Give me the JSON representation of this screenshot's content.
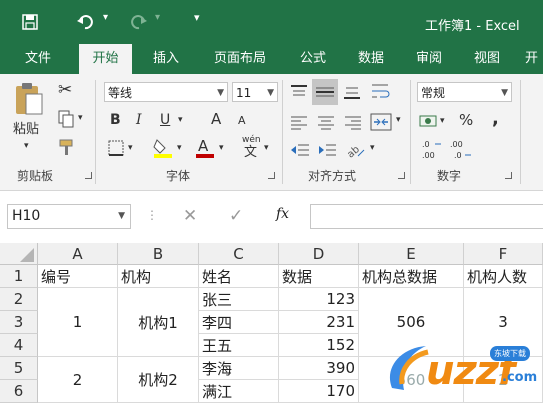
{
  "app": {
    "window_title": "工作簿1 - Excel"
  },
  "quick_access": {
    "save": "save-icon",
    "undo": "undo-icon",
    "redo": "redo-icon",
    "customize": "▾"
  },
  "tabs": [
    {
      "label": "文件"
    },
    {
      "label": "开始"
    },
    {
      "label": "插入"
    },
    {
      "label": "页面布局"
    },
    {
      "label": "公式"
    },
    {
      "label": "数据"
    },
    {
      "label": "审阅"
    },
    {
      "label": "视图"
    },
    {
      "label": "开"
    }
  ],
  "ribbon": {
    "clipboard": {
      "paste_label": "粘贴",
      "group_label": "剪贴板"
    },
    "font": {
      "font_name": "等线",
      "font_size": "11",
      "bold": "B",
      "italic": "I",
      "underline": "U",
      "grow": "A",
      "shrink": "A",
      "phonetic": "wén",
      "group_label": "字体"
    },
    "alignment": {
      "group_label": "对齐方式"
    },
    "number": {
      "format": "常规",
      "percent": "%",
      "comma": ",",
      "group_label": "数字"
    }
  },
  "formula_bar": {
    "name_box": "H10",
    "fx": "fx",
    "value": ""
  },
  "columns": [
    "A",
    "B",
    "C",
    "D",
    "E",
    "F"
  ],
  "rows": [
    "1",
    "2",
    "3",
    "4",
    "5",
    "6"
  ],
  "cells": {
    "A1": "编号",
    "B1": "机构",
    "C1": "姓名",
    "D1": "数据",
    "E1": "机构总数据",
    "F1": "机构人数",
    "C2": "张三",
    "D2": "123",
    "A3": "1",
    "B3": "机构1",
    "C3": "李四",
    "D3": "231",
    "E3": "506",
    "F3": "3",
    "C4": "王五",
    "D4": "152",
    "A5": "2",
    "B5": "机构2",
    "C5": "李海",
    "D5": "390",
    "E5": "560",
    "F5": "2",
    "C6": "满江",
    "D6": "170"
  },
  "watermark": {
    "text": "uzzf",
    "suffix": ".com",
    "badge": "东坡下载"
  },
  "colors": {
    "excel_green": "#217346",
    "font_color_red": "#c00000",
    "highlight_yellow": "#ffff00"
  }
}
